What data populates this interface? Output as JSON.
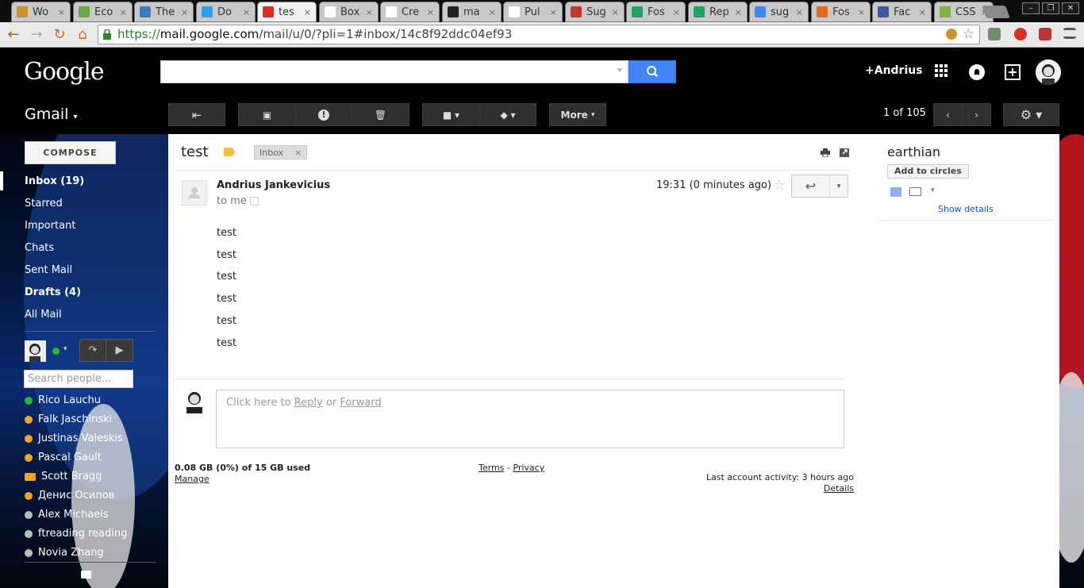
{
  "browser": {
    "tabs": [
      {
        "label": "Wo",
        "fav": "#c9902c"
      },
      {
        "label": "Eco",
        "fav": "#6aa84f"
      },
      {
        "label": "The",
        "fav": "#3b7bbf"
      },
      {
        "label": "Do",
        "fav": "#2f9ee8"
      },
      {
        "label": "tes",
        "fav": "#d93025",
        "active": true
      },
      {
        "label": "Box",
        "fav": "#ffffff"
      },
      {
        "label": "Cre",
        "fav": "#ffffff"
      },
      {
        "label": "ma",
        "fav": "#222222"
      },
      {
        "label": "Pul",
        "fav": "#ffffff"
      },
      {
        "label": "Sug",
        "fav": "#c0392b"
      },
      {
        "label": "Fos",
        "fav": "#21a366"
      },
      {
        "label": "Rep",
        "fav": "#21a366"
      },
      {
        "label": "sug",
        "fav": "#4285f4"
      },
      {
        "label": "Fos",
        "fav": "#e06c1b"
      },
      {
        "label": "Fac",
        "fav": "#3b5998"
      },
      {
        "label": "CSS",
        "fav": "#7cb342"
      }
    ],
    "tab_close": "×",
    "url_https": "https://",
    "url_domain": "mail.google.com",
    "url_path": "/mail/u/0/?pli=1#inbox/14c8f92ddc04ef93"
  },
  "gmail": {
    "logo": "Google",
    "user": "+Andrius",
    "app_label": "Gmail",
    "toolbar": {
      "more_label": "More",
      "count_label": "1 of 105"
    },
    "sidebar": {
      "compose_label": "COMPOSE",
      "nav": [
        {
          "label": "Inbox (19)",
          "bold": true
        },
        {
          "label": "Starred",
          "bold": false
        },
        {
          "label": "Important",
          "bold": false
        },
        {
          "label": "Chats",
          "bold": false
        },
        {
          "label": "Sent Mail",
          "bold": false
        },
        {
          "label": "Drafts (4)",
          "bold": true
        },
        {
          "label": "All Mail",
          "bold": false
        }
      ],
      "people_search_placeholder": "Search people...",
      "contacts": [
        {
          "name": "Rico Lauchu",
          "status": "#2bb03b"
        },
        {
          "name": "Falk Jaschinski",
          "status": "#f4a425"
        },
        {
          "name": "Justinas Valeskis",
          "status": "#f4a425"
        },
        {
          "name": "Pascal Gault",
          "status": "#f4a425"
        },
        {
          "name": "Scott Bragg",
          "status": "#f4a425"
        },
        {
          "name": "Денис Осипов",
          "status": "#f4a425"
        },
        {
          "name": "Alex Michaels",
          "status": "#bbbbbb"
        },
        {
          "name": "ftreading reading",
          "status": "#bbbbbb"
        },
        {
          "name": "Novia Zhang",
          "status": "#bbbbbb"
        }
      ]
    },
    "message": {
      "subject": "test",
      "label_chip": "Inbox",
      "label_chip_close": "×",
      "sender": "Andrius Jankevicius",
      "to": "to me",
      "timestamp": "19:31 (0 minutes ago)",
      "body_lines": [
        "test",
        "test",
        "test",
        "test",
        "test",
        "test"
      ],
      "reply_prompt_prefix": "Click here to ",
      "reply_link": "Reply",
      "reply_or": " or ",
      "forward_link": "Forward"
    },
    "footer": {
      "storage": "0.08 GB (0%) of 15 GB used",
      "manage": "Manage",
      "terms": "Terms",
      "dash": " - ",
      "privacy": "Privacy",
      "last_activity": "Last account activity: 3 hours ago",
      "details": "Details"
    },
    "right_panel": {
      "name": "earthian",
      "add_to_circles": "Add to circles",
      "show_details": "Show details"
    }
  }
}
